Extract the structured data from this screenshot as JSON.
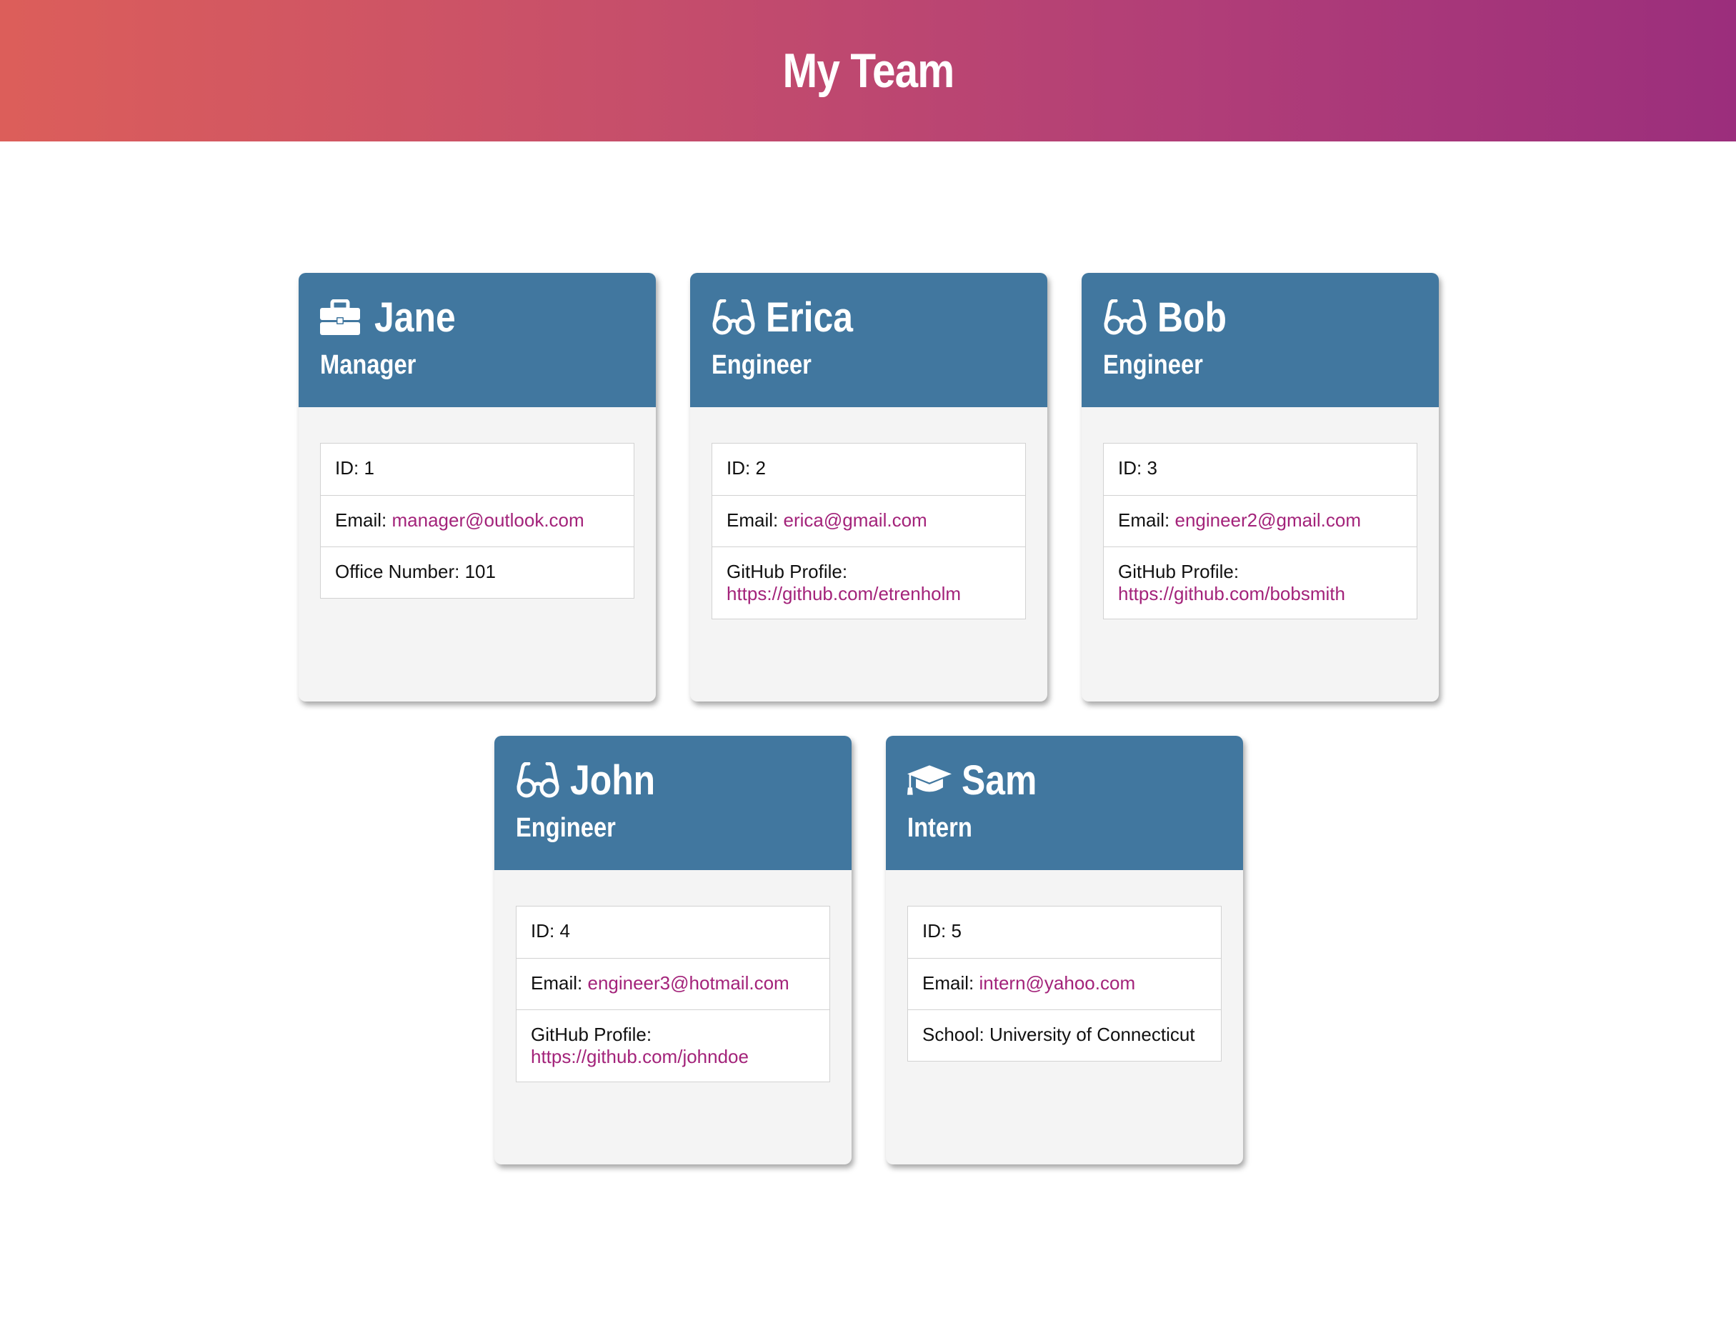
{
  "header": {
    "title": "My Team"
  },
  "colors": {
    "card_head": "#41779f",
    "link": "#a3237a"
  },
  "employees": [
    {
      "name": "Jane",
      "role": "Manager",
      "icon": "briefcase-icon",
      "id_text": "ID: 1",
      "email_label": "Email:",
      "email": "manager@outlook.com",
      "extra_label": "Office Number:",
      "extra_value": "101"
    },
    {
      "name": "Erica",
      "role": "Engineer",
      "icon": "glasses-icon",
      "id_text": "ID: 2",
      "email_label": "Email:",
      "email": "erica@gmail.com",
      "extra_label": "GitHub Profile:",
      "extra_value": "https://github.com/etrenholm"
    },
    {
      "name": "Bob",
      "role": "Engineer",
      "icon": "glasses-icon",
      "id_text": "ID: 3",
      "email_label": "Email:",
      "email": "engineer2@gmail.com",
      "extra_label": "GitHub Profile:",
      "extra_value": "https://github.com/bobsmith"
    },
    {
      "name": "John",
      "role": "Engineer",
      "icon": "glasses-icon",
      "id_text": "ID: 4",
      "email_label": "Email:",
      "email": "engineer3@hotmail.com",
      "extra_label": "GitHub Profile:",
      "extra_value": "https://github.com/johndoe"
    },
    {
      "name": "Sam",
      "role": "Intern",
      "icon": "graduation-cap-icon",
      "id_text": "ID: 5",
      "email_label": "Email:",
      "email": "intern@yahoo.com",
      "extra_label": "School:",
      "extra_value": "University of Connecticut"
    }
  ]
}
